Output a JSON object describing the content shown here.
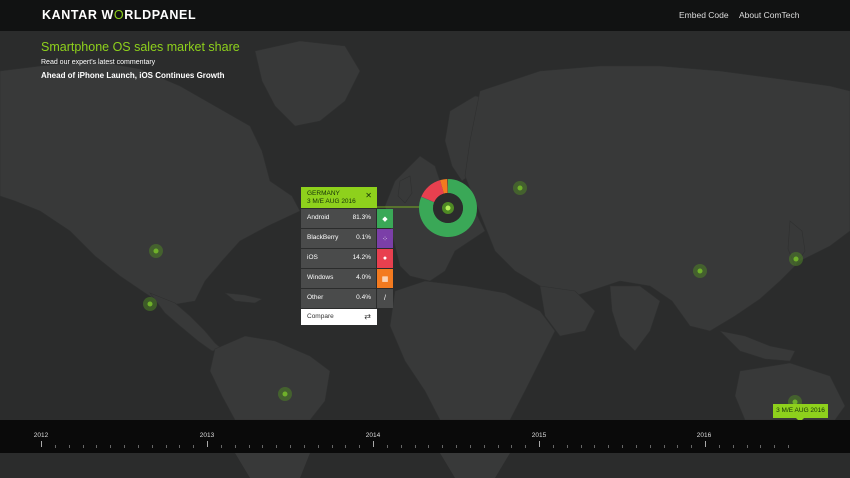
{
  "header": {
    "logo_main": "KANTAR W",
    "logo_accent": "O",
    "logo_rest": "RLDPANEL",
    "nav": [
      "Embed Code",
      "About ComTech"
    ]
  },
  "headline": {
    "title": "Smartphone OS sales market share",
    "subtitle": "Read our expert's latest commentary",
    "commentary": "Ahead of iPhone Launch, iOS Continues Growth"
  },
  "popup": {
    "country": "GERMANY",
    "period": "3 M/E AUG 2016",
    "close_icon": "close-icon",
    "rows": [
      {
        "label": "Android",
        "value": "81.3%",
        "share": 81.3,
        "color": "#3aa857",
        "icon": "android-icon"
      },
      {
        "label": "BlackBerry",
        "value": "0.1%",
        "share": 0.1,
        "color": "#7b3fa8",
        "icon": "blackberry-icon"
      },
      {
        "label": "iOS",
        "value": "14.2%",
        "share": 14.2,
        "color": "#e8404f",
        "icon": "apple-icon"
      },
      {
        "label": "Windows",
        "value": "4.0%",
        "share": 4.0,
        "color": "#f37a1f",
        "icon": "windows-icon"
      },
      {
        "label": "Other",
        "value": "0.4%",
        "share": 0.4,
        "color": "#4a4b4b",
        "icon": "slash-icon"
      }
    ],
    "compare_label": "Compare",
    "compare_icon": "swap-icon"
  },
  "timeline": {
    "years": [
      "2012",
      "2013",
      "2014",
      "2015",
      "2016"
    ],
    "selected": "3 M/E AUG 2016"
  },
  "colors": {
    "accent": "#8ed11c",
    "map_bg": "#2b2c2c",
    "land": "#383939",
    "marker": "#4f8a24"
  }
}
